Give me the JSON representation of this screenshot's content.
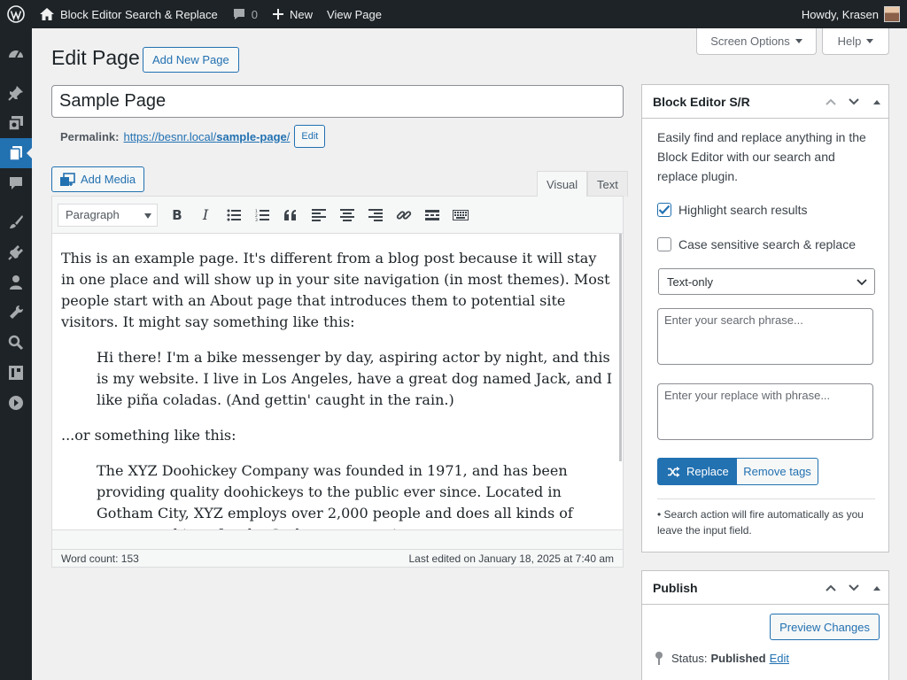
{
  "adminbar": {
    "site_name": "Block Editor Search & Replace",
    "comments_count": "0",
    "new_label": "New",
    "view_page_label": "View Page",
    "howdy": "Howdy, Krasen"
  },
  "screen_meta": {
    "screen_options": "Screen Options",
    "help": "Help"
  },
  "page": {
    "heading": "Edit Page",
    "add_new": "Add New Page",
    "post_title": "Sample Page",
    "permalink_label": "Permalink:",
    "permalink_base": "https://besnr.local/",
    "permalink_slug": "sample-page",
    "permalink_trail": "/",
    "permalink_edit": "Edit",
    "add_media": "Add Media",
    "tab_visual": "Visual",
    "tab_text": "Text",
    "format_select": "Paragraph",
    "content": {
      "p1": "This is an example page. It's different from a blog post because it will stay in one place and will show up in your site navigation (in most themes). Most people start with an About page that introduces them to potential site visitors. It might say something like this:",
      "quote1": "Hi there! I'm a bike messenger by day, aspiring actor by night, and this is my website. I live in Los Angeles, have a great dog named Jack, and I like piña coladas. (And gettin' caught in the rain.)",
      "p2": "...or something like this:",
      "quote2": "The XYZ Doohickey Company was founded in 1971, and has been providing quality doohickeys to the public ever since. Located in Gotham City, XYZ employs over 2,000 people and does all kinds of awesome things for the Gotham community."
    },
    "word_count": "Word count: 153",
    "last_edited": "Last edited on January 18, 2025 at 7:40 am"
  },
  "snr_box": {
    "title": "Block Editor S/R",
    "description": "Easily find and replace anything in the Block Editor with our search and replace plugin.",
    "highlight_label": "Highlight search results",
    "highlight_checked": true,
    "case_label": "Case sensitive search & replace",
    "case_checked": false,
    "mode_selected": "Text-only",
    "search_placeholder": "Enter your search phrase...",
    "replace_placeholder": "Enter your replace with phrase...",
    "replace_button": "Replace",
    "remove_tags_button": "Remove tags",
    "note": "• Search action will fire automatically as you leave the input field."
  },
  "publish_box": {
    "title": "Publish",
    "preview_button": "Preview Changes",
    "status_label": "Status:",
    "status_value": "Published",
    "status_edit": "Edit"
  },
  "colors": {
    "admin_dark": "#1d2327",
    "accent": "#2271b1",
    "background": "#f0f0f1"
  }
}
